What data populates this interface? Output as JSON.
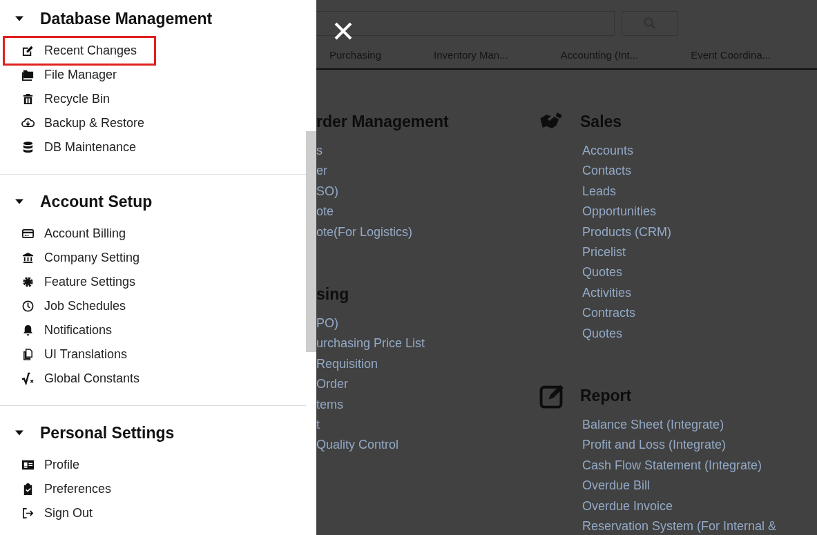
{
  "drawer": {
    "sections": [
      {
        "title": "Database Management",
        "expanded": true,
        "items": [
          {
            "label": "Recent Changes",
            "highlighted": true
          },
          {
            "label": "File Manager",
            "highlighted": false
          },
          {
            "label": "Recycle Bin",
            "highlighted": false
          },
          {
            "label": "Backup & Restore",
            "highlighted": false
          },
          {
            "label": "DB Maintenance",
            "highlighted": false
          }
        ]
      },
      {
        "title": "Account Setup",
        "expanded": true,
        "items": [
          {
            "label": "Account Billing",
            "highlighted": false
          },
          {
            "label": "Company Setting",
            "highlighted": false
          },
          {
            "label": "Feature Settings",
            "highlighted": false
          },
          {
            "label": "Job Schedules",
            "highlighted": false
          },
          {
            "label": "Notifications",
            "highlighted": false
          },
          {
            "label": "UI Translations",
            "highlighted": false
          },
          {
            "label": "Global Constants",
            "highlighted": false
          }
        ]
      },
      {
        "title": "Personal Settings",
        "expanded": true,
        "items": [
          {
            "label": "Profile",
            "highlighted": false
          },
          {
            "label": "Preferences",
            "highlighted": false
          },
          {
            "label": "Sign Out",
            "highlighted": false
          }
        ]
      }
    ]
  },
  "tabs": [
    {
      "label": "Purchasing"
    },
    {
      "label": "Inventory Man..."
    },
    {
      "label": "Accounting (Int..."
    },
    {
      "label": "Event Coordina..."
    }
  ],
  "columns": [
    [
      {
        "title": "rder Management",
        "links": [
          "s",
          "er",
          "SO)",
          "ote",
          "ote(For Logistics)"
        ]
      },
      {
        "title": "sing",
        "links": [
          "PO)",
          "urchasing Price List",
          "Requisition",
          "Order",
          "tems",
          "t",
          "Quality Control"
        ]
      }
    ],
    [
      {
        "title": "Sales",
        "links": [
          "Accounts",
          "Contacts",
          "Leads",
          "Opportunities",
          "Products (CRM)",
          "Pricelist",
          "Quotes",
          "Activities",
          "Contracts",
          "Quotes"
        ]
      },
      {
        "title": "Report",
        "links": [
          "Balance Sheet (Integrate)",
          "Profit and Loss (Integrate)",
          "Cash Flow Statement (Integrate)",
          "Overdue Bill",
          "Overdue Invoice",
          "Reservation System (For Internal &"
        ]
      }
    ]
  ]
}
